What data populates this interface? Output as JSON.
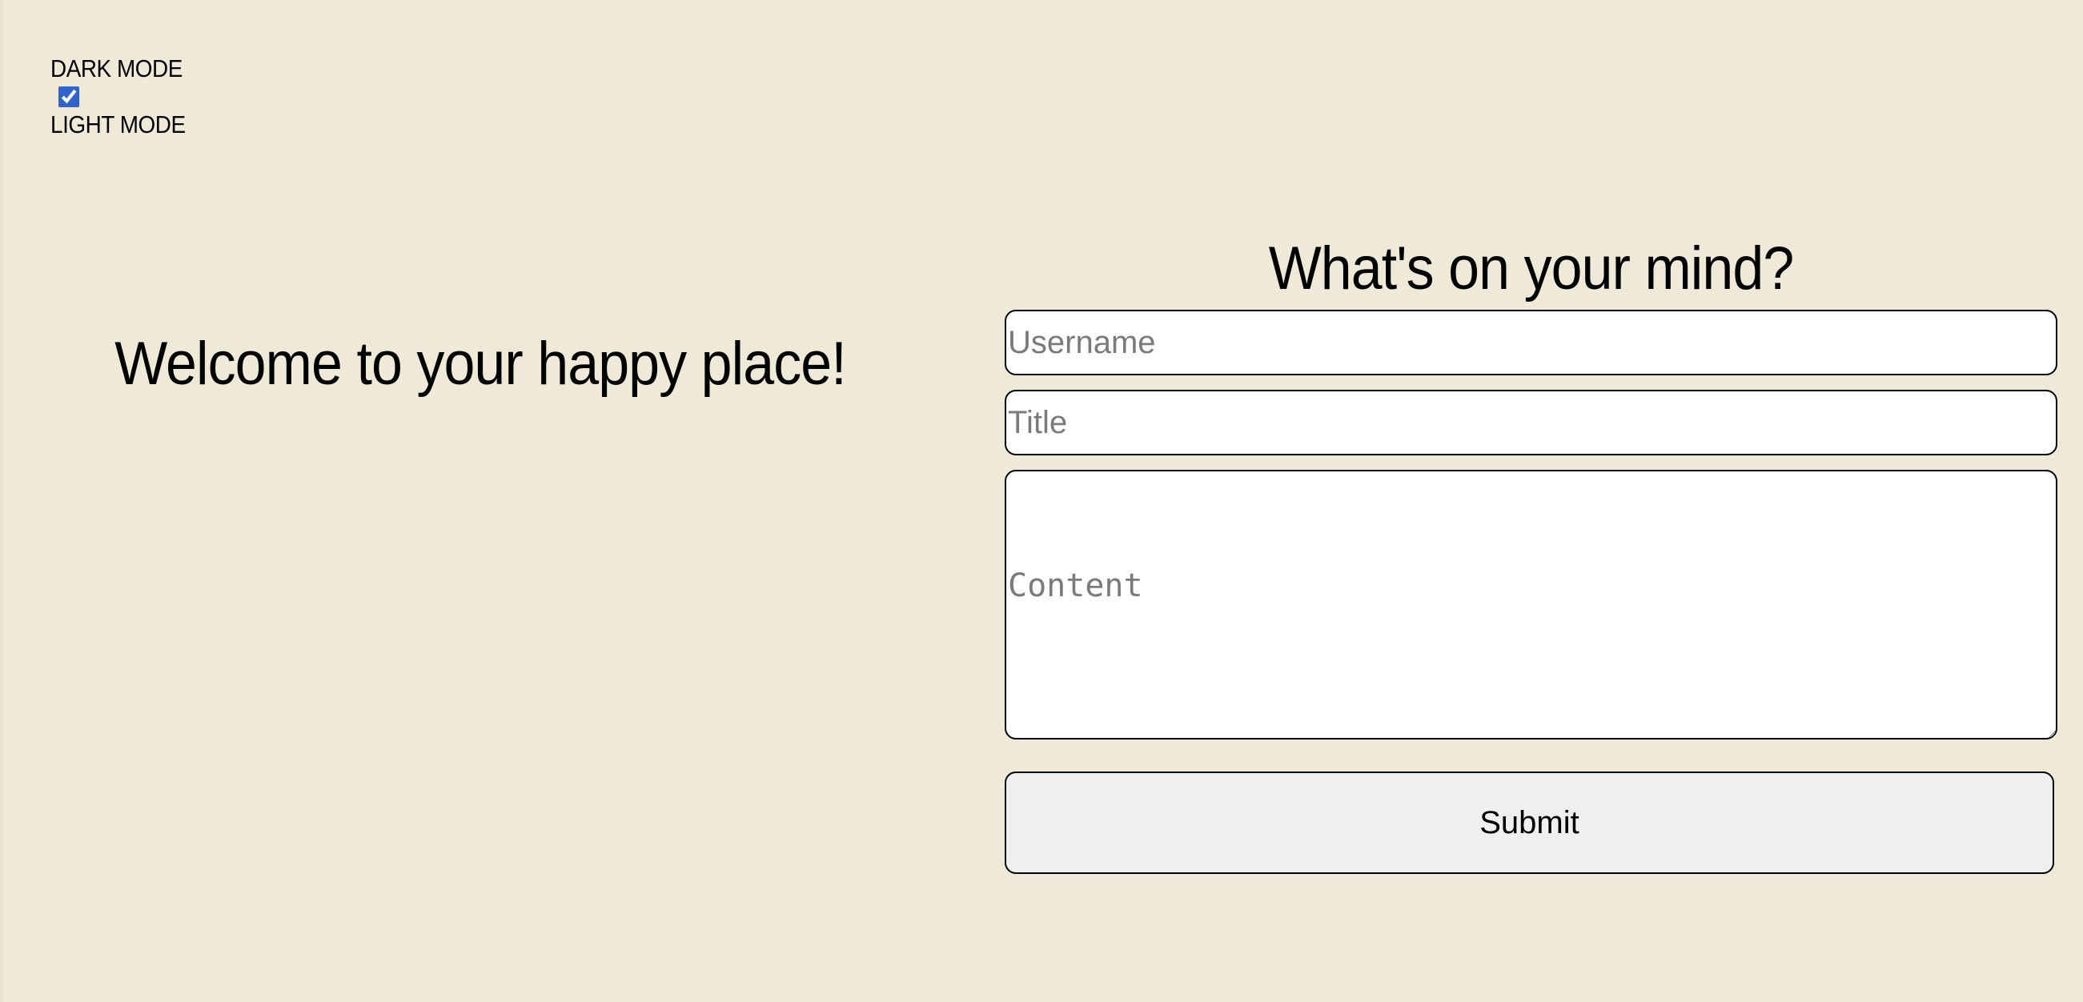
{
  "theme_toggle": {
    "dark_label": "DARK MODE",
    "light_label": "LIGHT MODE",
    "checked": true
  },
  "welcome": {
    "heading": "Welcome to your happy place!"
  },
  "form": {
    "title": "What's on your mind?",
    "username_placeholder": "Username",
    "title_placeholder": "Title",
    "content_placeholder": "Content",
    "submit_label": "Submit"
  },
  "colors": {
    "background": "#efe9d7",
    "field_background": "#ffffff",
    "button_background": "#efefef",
    "checkbox_accent": "#2f63c9"
  }
}
